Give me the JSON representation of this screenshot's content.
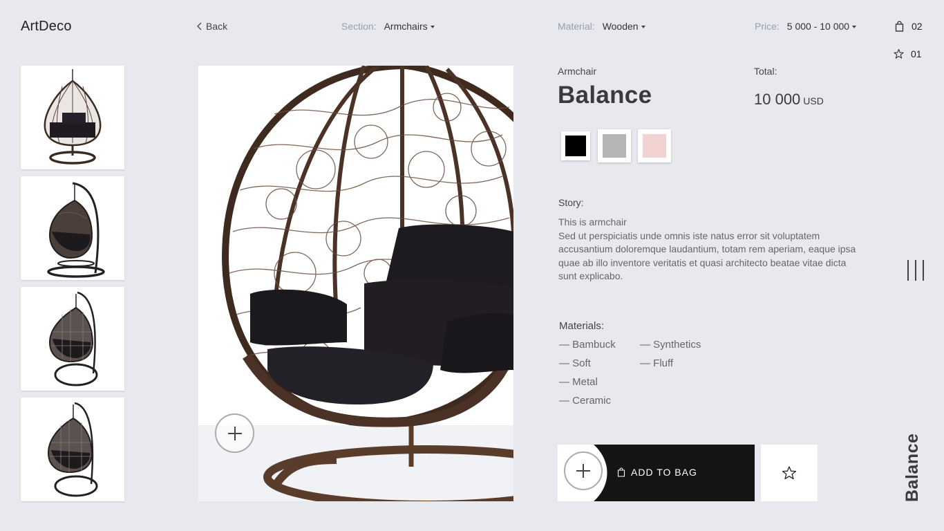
{
  "brand": {
    "name": "ArtDeco"
  },
  "nav": {
    "back_label": "Back"
  },
  "filters": {
    "section": {
      "label": "Section:",
      "value": "Armchairs"
    },
    "material": {
      "label": "Material:",
      "value": "Wooden"
    },
    "price": {
      "label": "Price:",
      "value": "5 000 - 10 000"
    }
  },
  "counters": {
    "bag": "02",
    "favorites": "01"
  },
  "thumbnails": [
    {
      "name": "thumb-front"
    },
    {
      "name": "thumb-side"
    },
    {
      "name": "thumb-angle"
    },
    {
      "name": "thumb-angle-2"
    }
  ],
  "product": {
    "category": "Armchair",
    "title": "Balance",
    "total_label": "Total:",
    "price": "10 000",
    "currency": "USD",
    "colors": [
      "#000000",
      "#b5b5b5",
      "#f3d3d2"
    ],
    "story_label": "Story:",
    "story_lines": [
      "This is armchair",
      "Sed ut perspiciatis unde omnis iste natus error sit voluptatem accusantium doloremque laudantium, totam rem aperiam, eaque ipsa quae ab illo inventore veritatis et quasi architecto beatae vitae dicta sunt explicabo."
    ],
    "materials_label": "Materials:",
    "materials_col1": [
      "— Bambuck",
      "— Soft",
      "— Metal",
      "— Ceramic"
    ],
    "materials_col2": [
      "— Synthetics",
      "— Fluff"
    ]
  },
  "actions": {
    "add_to_bag": "ADD TO BAG"
  },
  "side_title": "Balance",
  "icons": {
    "back": "chevron-left-icon",
    "bag": "shopping-bag-icon",
    "star": "star-icon",
    "plus": "plus-icon",
    "menu": "menu-bars-icon"
  }
}
